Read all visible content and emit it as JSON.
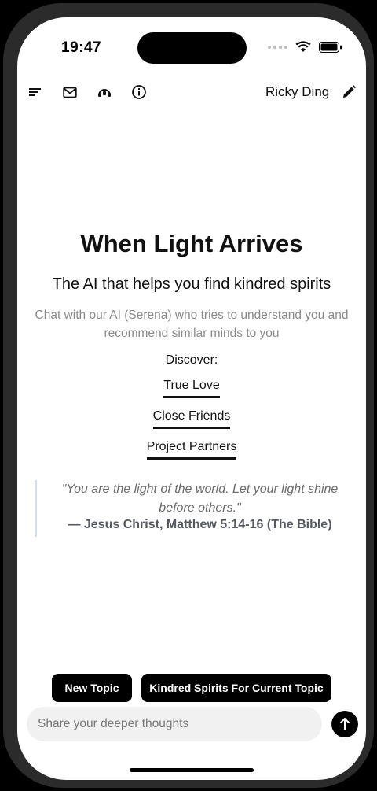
{
  "status": {
    "time": "19:47"
  },
  "toolbar": {
    "icons": [
      "menu-icon",
      "mail-icon",
      "support-icon",
      "info-icon",
      "edit-icon"
    ],
    "username": "Ricky Ding"
  },
  "hero": {
    "title": "When Light Arrives",
    "subtitle": "The AI that helps you find kindred spirits",
    "description": "Chat with our AI (Serena) who tries to understand you and recommend similar minds to you",
    "discover_label": "Discover:",
    "links": [
      "True Love",
      "Close Friends",
      "Project Partners"
    ]
  },
  "quote": {
    "text": "\"You are the light of the world. Let your light shine before others.\"",
    "attribution": "— Jesus Christ, Matthew 5:14-16 (The Bible)"
  },
  "actions": {
    "new_topic": "New Topic",
    "kindred_spirits": "Kindred Spirits For Current Topic"
  },
  "composer": {
    "placeholder": "Share your deeper thoughts"
  },
  "colors": {
    "accent": "#000000",
    "muted_text": "#8a8a8a",
    "input_bg": "#f1f1f1"
  }
}
